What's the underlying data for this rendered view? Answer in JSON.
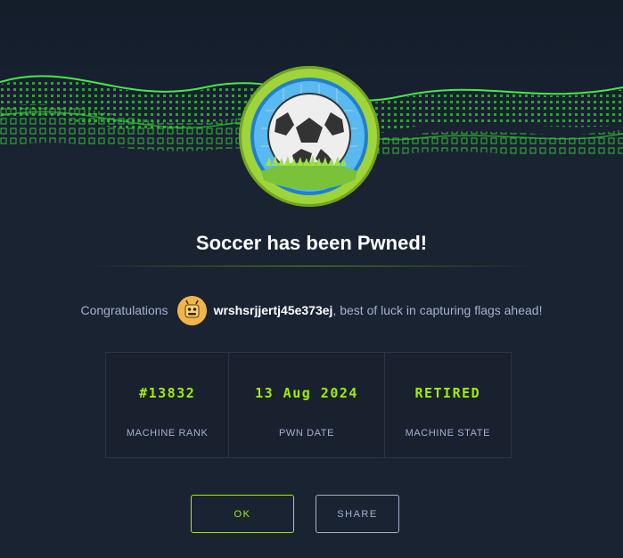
{
  "header": {
    "title": "Soccer has been Pwned!"
  },
  "congrats": {
    "prefix": "Congratulations",
    "username": "wrshsrjjertj45e373ej",
    "suffix": ", best of luck in capturing flags ahead!"
  },
  "stats": [
    {
      "value": "#13832",
      "label": "MACHINE RANK"
    },
    {
      "value": "13 Aug 2024",
      "label": "PWN DATE"
    },
    {
      "value": "RETIRED",
      "label": "MACHINE STATE"
    }
  ],
  "buttons": {
    "ok": "OK",
    "share": "SHARE"
  },
  "colors": {
    "accent": "#9fef00",
    "background": "#1a2332",
    "muted": "#a4b1cd"
  },
  "icons": {
    "badge": "soccer-ball-icon",
    "avatar": "user-avatar-icon"
  }
}
